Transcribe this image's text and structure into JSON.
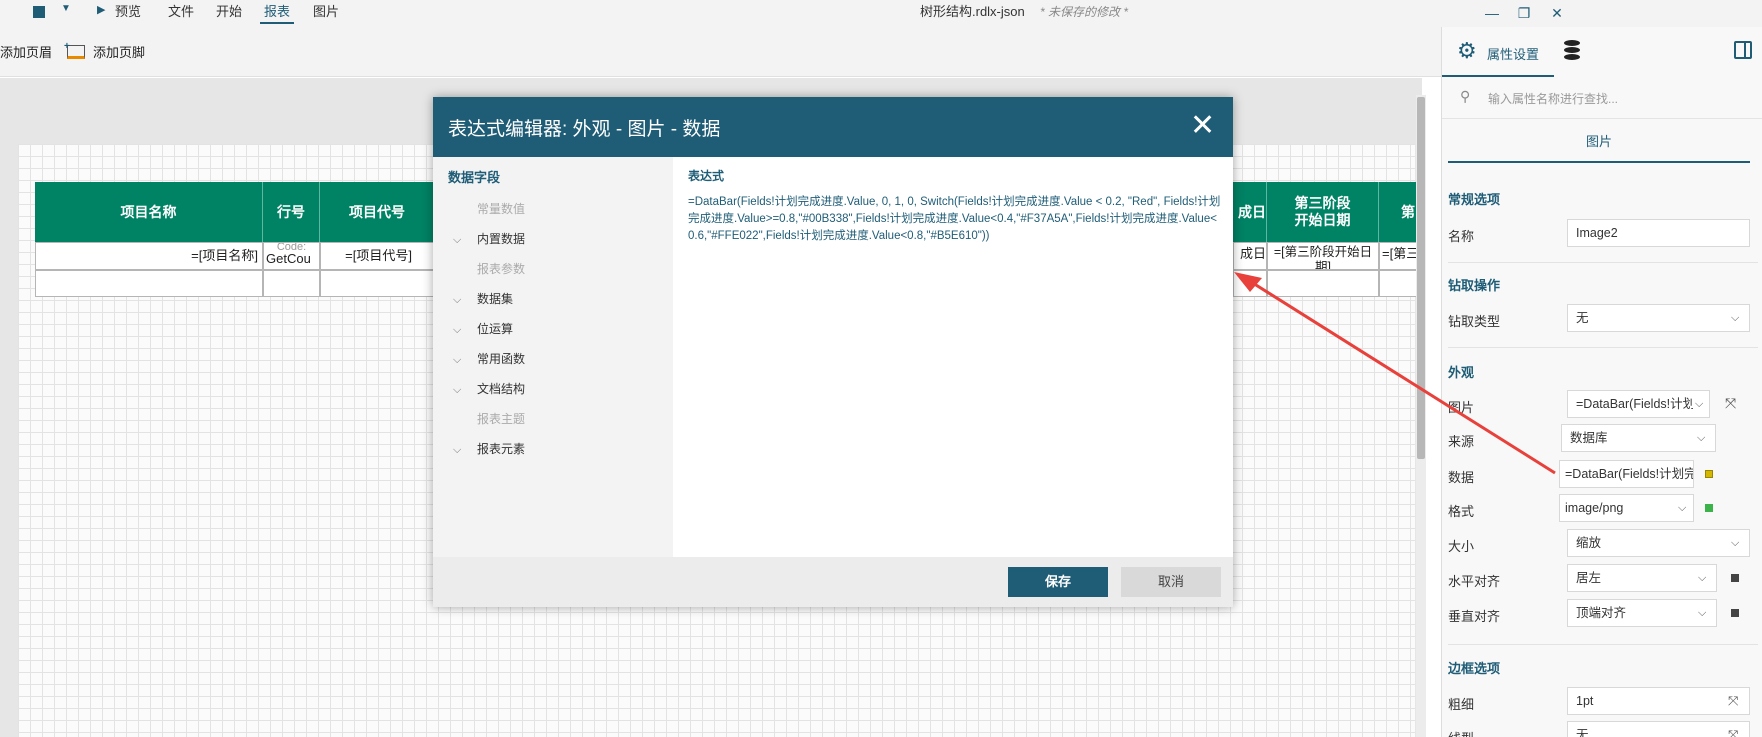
{
  "menubar": {
    "preview": "预览",
    "menus": [
      "文件",
      "开始",
      "报表",
      "图片"
    ],
    "doc_title": "树形结构.rdlx-json",
    "unsaved": "* 未保存的修改 *"
  },
  "toolbar": {
    "add_header": "添加页眉",
    "add_footer": "添加页脚"
  },
  "report_table": {
    "headers": [
      "项目名称",
      "行号",
      "项目代号",
      "成日",
      "第三阶段\n开始日期",
      "第"
    ],
    "row1": [
      "=[项目名称]",
      "GetCou",
      "=[项目代号]",
      "成日",
      "=[第三阶段开始日期]",
      "=[第三"
    ],
    "row1_extra": "Code:"
  },
  "dialog": {
    "title": "表达式编辑器: 外观 - 图片 - 数据",
    "fields_title": "数据字段",
    "tree": [
      {
        "label": "常量数值",
        "expandable": false,
        "disabled": true
      },
      {
        "label": "内置数据",
        "expandable": true,
        "disabled": false
      },
      {
        "label": "报表参数",
        "expandable": false,
        "disabled": true
      },
      {
        "label": "数据集",
        "expandable": true,
        "disabled": false
      },
      {
        "label": "位运算",
        "expandable": true,
        "disabled": false
      },
      {
        "label": "常用函数",
        "expandable": true,
        "disabled": false
      },
      {
        "label": "文档结构",
        "expandable": true,
        "disabled": false
      },
      {
        "label": "报表主题",
        "expandable": false,
        "disabled": true
      },
      {
        "label": "报表元素",
        "expandable": true,
        "disabled": false
      }
    ],
    "expr_label": "表达式",
    "expression": "=DataBar(Fields!计划完成进度.Value, 0, 1, 0, Switch(Fields!计划完成进度.Value < 0.2, \"Red\", Fields!计划完成进度.Value>=0.8,\"#00B338\",Fields!计划完成进度.Value<0.4,\"#F37A5A\",Fields!计划完成进度.Value<0.6,\"#FFE022\",Fields!计划完成进度.Value<0.8,\"#B5E610\"))",
    "save": "保存",
    "cancel": "取消"
  },
  "panel": {
    "tab_properties": "属性设置",
    "search_placeholder": "输入属性名称进行查找...",
    "section": "图片",
    "groups": {
      "general": "常规选项",
      "drill": "钻取操作",
      "appearance": "外观",
      "border": "边框选项"
    },
    "props": {
      "name_label": "名称",
      "name_value": "Image2",
      "drill_label": "钻取类型",
      "drill_value": "无",
      "image_label": "图片",
      "image_value": "=DataBar(Fields!计划",
      "source_label": "来源",
      "source_value": "数据库",
      "data_label": "数据",
      "data_value": "=DataBar(Fields!计划完成",
      "format_label": "格式",
      "format_value": "image/png",
      "size_label": "大小",
      "size_value": "缩放",
      "halign_label": "水平对齐",
      "halign_value": "居左",
      "valign_label": "垂直对齐",
      "valign_value": "顶端对齐",
      "width_label": "粗细",
      "width_value": "1pt",
      "style_label": "线型",
      "style_value": "无"
    }
  },
  "colors": {
    "accent": "#1f5d77",
    "table_header": "#008264",
    "arrow": "#e8403a",
    "data_dot": "#d4b800",
    "format_dot": "#3cb34a",
    "align_dot": "#444444"
  }
}
